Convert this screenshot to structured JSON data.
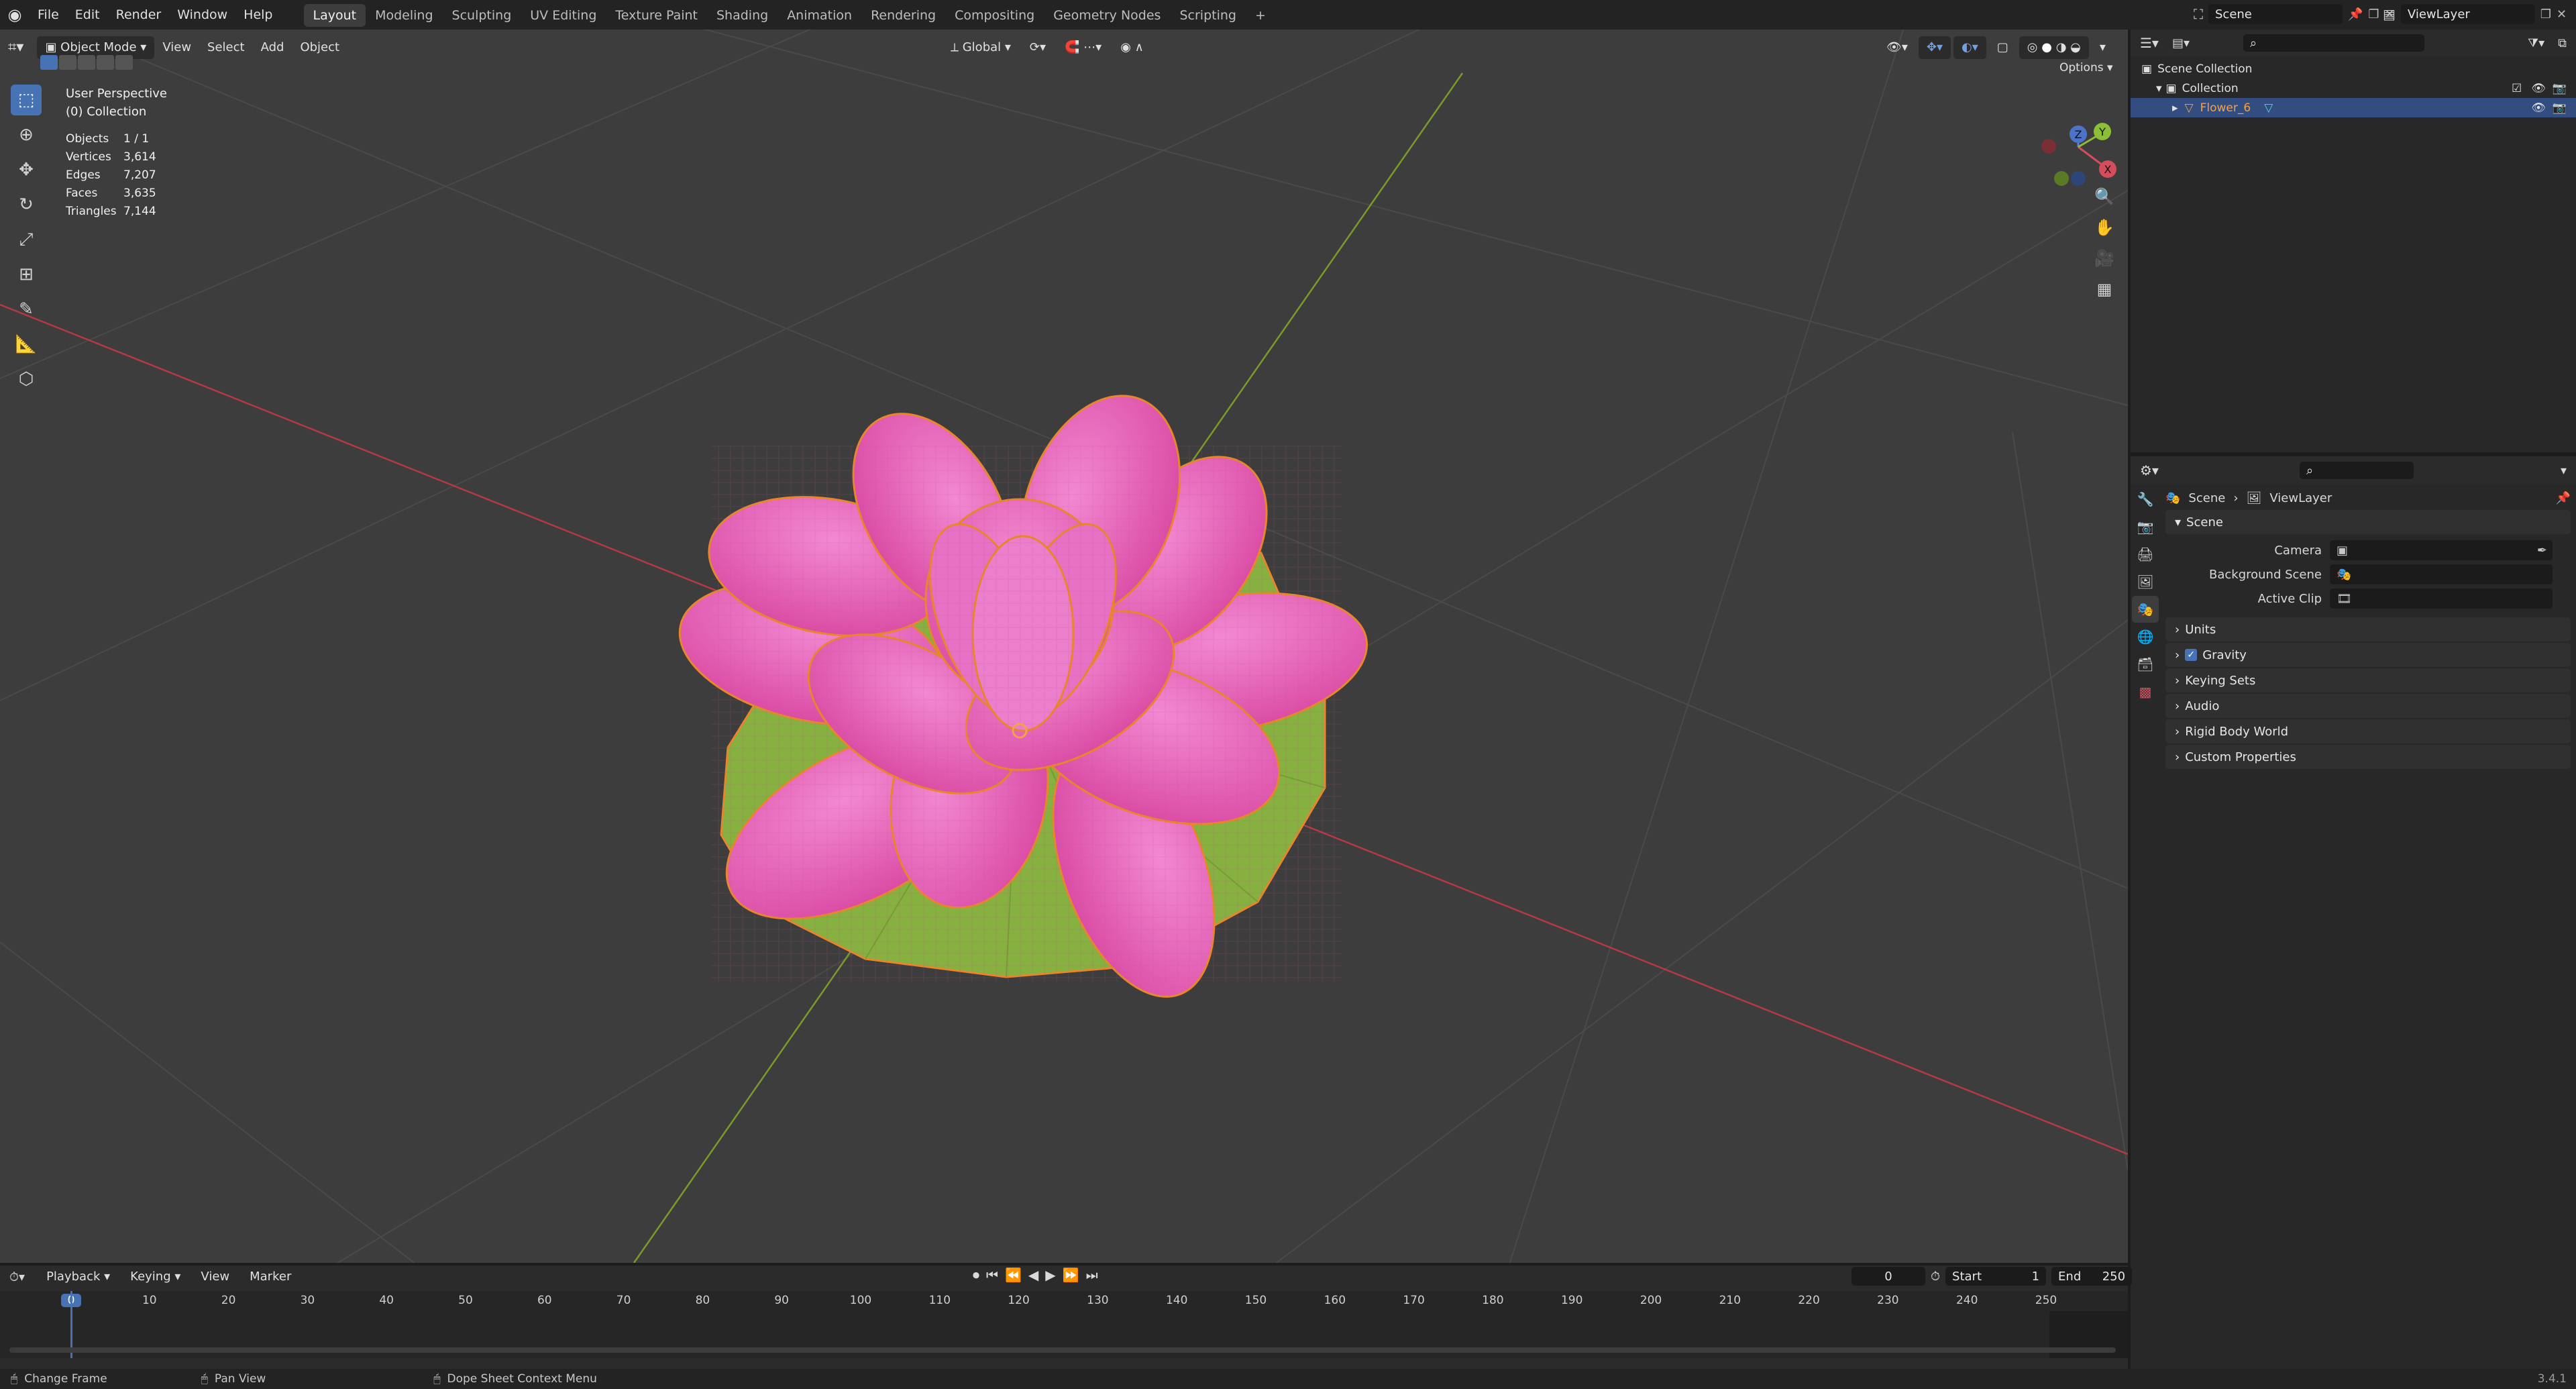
{
  "topbar": {
    "menus": [
      "File",
      "Edit",
      "Render",
      "Window",
      "Help"
    ],
    "workspaces": [
      "Layout",
      "Modeling",
      "Sculpting",
      "UV Editing",
      "Texture Paint",
      "Shading",
      "Animation",
      "Rendering",
      "Compositing",
      "Geometry Nodes",
      "Scripting"
    ],
    "active_workspace": "Layout",
    "add_tab": "+",
    "scene": "Scene",
    "view_layer": "ViewLayer"
  },
  "viewport": {
    "mode": "Object Mode",
    "menus": [
      "View",
      "Select",
      "Add",
      "Object"
    ],
    "orientation": "Global",
    "options": "Options",
    "overlay_title": "User Perspective",
    "overlay_collection": "(0) Collection",
    "stats": [
      {
        "label": "Objects",
        "value": "1 / 1"
      },
      {
        "label": "Vertices",
        "value": "3,614"
      },
      {
        "label": "Edges",
        "value": "7,207"
      },
      {
        "label": "Faces",
        "value": "3,635"
      },
      {
        "label": "Triangles",
        "value": "7,144"
      }
    ],
    "gizmo": {
      "z": "Z",
      "y": "Y",
      "x": "X"
    },
    "colors": {
      "background": "#3d3d3d",
      "x_axis": "#c0404a",
      "y_axis": "#8fb02e",
      "petal": "#e15ab9",
      "leaf": "#86b040",
      "selection": "#f08a2c"
    }
  },
  "outliner": {
    "root": "Scene Collection",
    "collection": "Collection",
    "object": "Flower_6"
  },
  "properties": {
    "breadcrumb_scene": "Scene",
    "breadcrumb_layer": "ViewLayer",
    "panel_title": "Scene",
    "fields": [
      {
        "label": "Camera",
        "value": ""
      },
      {
        "label": "Background Scene",
        "value": ""
      },
      {
        "label": "Active Clip",
        "value": ""
      }
    ],
    "subpanels": [
      "Units",
      "Gravity",
      "Keying Sets",
      "Audio",
      "Rigid Body World",
      "Custom Properties"
    ]
  },
  "timeline": {
    "menus": [
      "Playback",
      "Keying",
      "View",
      "Marker"
    ],
    "current_frame": "0",
    "start_label": "Start",
    "start": "1",
    "end_label": "End",
    "end": "250",
    "ruler": [
      "0",
      "10",
      "20",
      "30",
      "40",
      "50",
      "60",
      "70",
      "80",
      "90",
      "100",
      "110",
      "120",
      "130",
      "140",
      "150",
      "160",
      "170",
      "180",
      "190",
      "200",
      "210",
      "220",
      "230",
      "240",
      "250"
    ]
  },
  "statusbar": {
    "hint1": "Change Frame",
    "hint2": "Pan View",
    "hint3": "Dope Sheet Context Menu",
    "version": "3.4.1"
  }
}
